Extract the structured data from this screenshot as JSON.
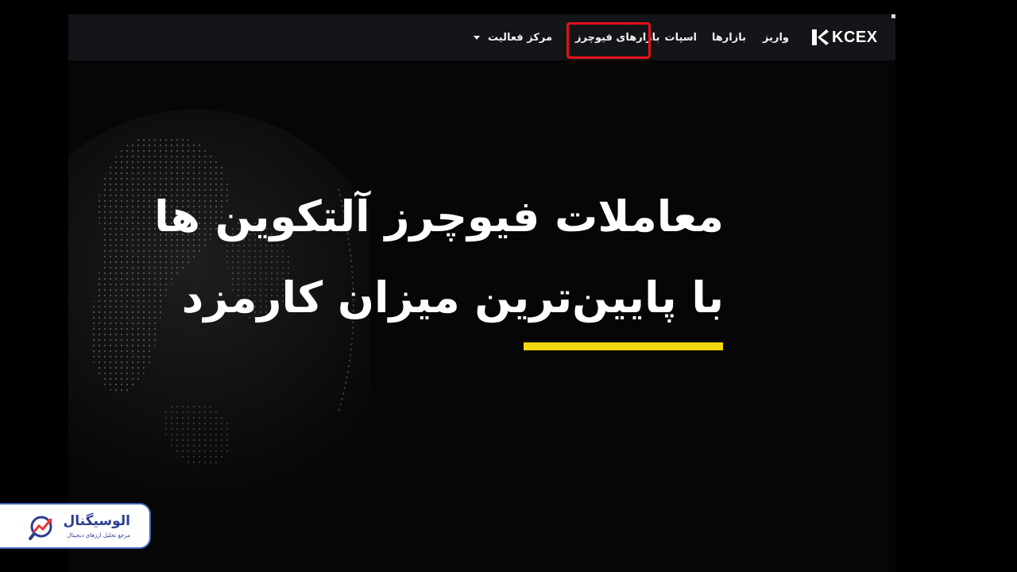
{
  "navbar": {
    "logo_text": "KCEX",
    "items": [
      {
        "label": "واریز"
      },
      {
        "label": "بازارها"
      },
      {
        "label": "اسپات"
      },
      {
        "label": "بازارهای فیوچرز",
        "highlighted": true
      },
      {
        "label": "مرکز فعالیت",
        "has_dropdown": true
      }
    ]
  },
  "hero": {
    "line1": "معاملات  فیوچرز آلتکوین ها",
    "line2": "با پایین‌ترین میزان کارمزد"
  },
  "brand_badge": {
    "name": "الوسیگنال",
    "tagline": "مرجع تحلیل ارزهای دیجیتال"
  },
  "colors": {
    "background": "#000000",
    "navbar": "#141518",
    "highlight": "#e5121b",
    "accent_line": "#f3d60f",
    "brand": "#2b3d8f"
  },
  "icons": {
    "logo": "kcex-logo-icon",
    "dropdown": "caret-down-icon",
    "brand": "chart-magnifier-icon"
  }
}
